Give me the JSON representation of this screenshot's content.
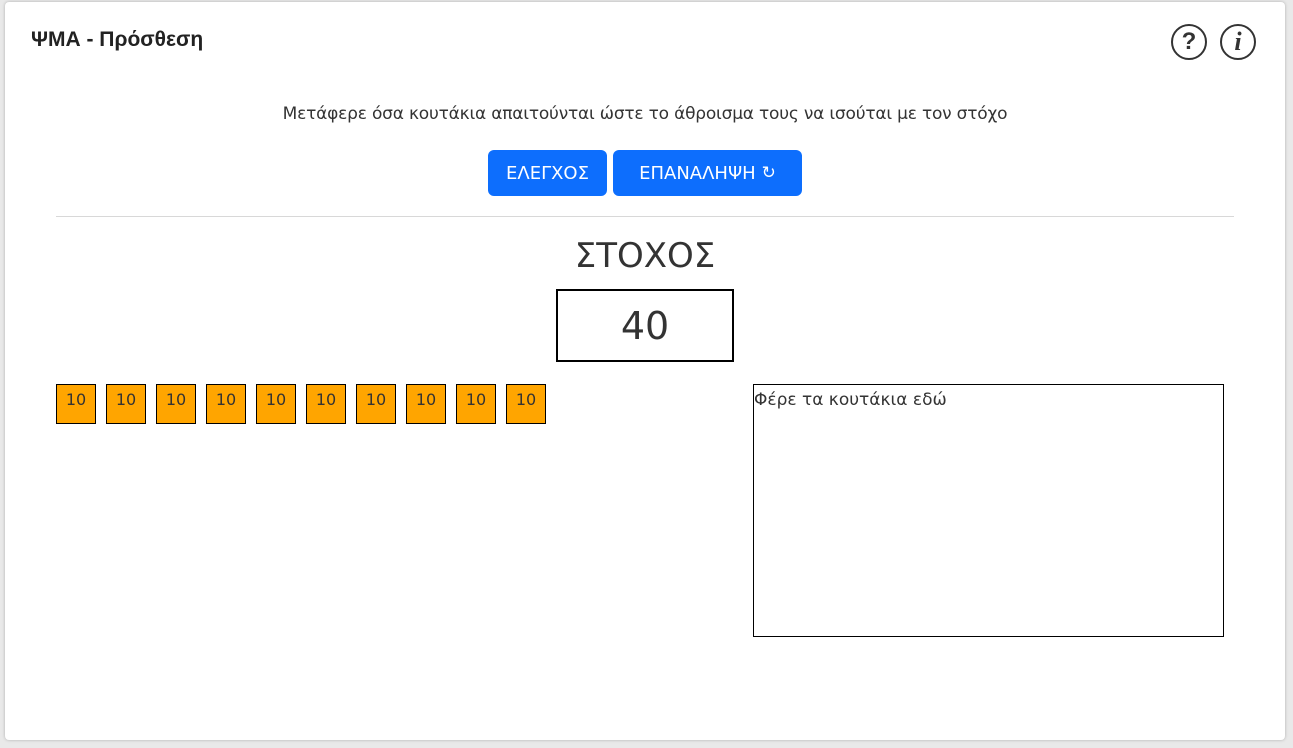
{
  "header": {
    "title": "ΨΜΑ - Πρόσθεση",
    "help_icon": "question-circle-icon",
    "help_glyph": "?",
    "info_icon": "info-circle-icon",
    "info_glyph": "i"
  },
  "instruction": "Μετάφερε όσα κουτάκια απαιτούνται ώστε το άθροισμα τους να ισούται με τον στόχο",
  "buttons": {
    "check_label": "ΕΛΕΓΧΟΣ",
    "reset_label": "ΕΠΑΝΑΛΗΨΗ",
    "reset_icon": "refresh-icon",
    "color": "#0d6efd"
  },
  "target": {
    "label": "ΣΤΟΧΟΣ",
    "value": "40"
  },
  "tiles": {
    "color": "#ffa500",
    "values": [
      "10",
      "10",
      "10",
      "10",
      "10",
      "10",
      "10",
      "10",
      "10",
      "10"
    ]
  },
  "dropzone": {
    "label": "Φέρε τα κουτάκια εδώ"
  }
}
